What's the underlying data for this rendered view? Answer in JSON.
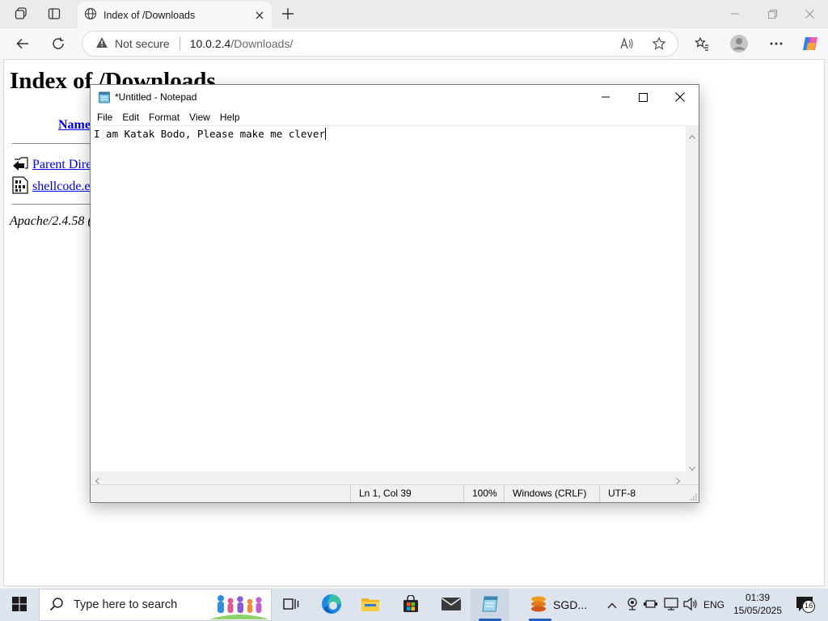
{
  "browser": {
    "tab_title": "Index of /Downloads",
    "security_label": "Not secure",
    "url_host": "10.0.2.4",
    "url_path": "/Downloads/"
  },
  "page": {
    "heading": "Index of /Downloads",
    "column_name": "Name",
    "rows": [
      {
        "label": "Parent Dire",
        "icon": "back-folder-icon"
      },
      {
        "label": "shellcode.e",
        "icon": "binary-file-icon"
      }
    ],
    "server_signature": "Apache/2.4.58 ("
  },
  "notepad": {
    "title": "*Untitled - Notepad",
    "menu": [
      "File",
      "Edit",
      "Format",
      "View",
      "Help"
    ],
    "content": "I am Katak Bodo, Please make me clever",
    "status": {
      "position": "Ln 1, Col 39",
      "zoom": "100%",
      "line_ending": "Windows (CRLF)",
      "encoding": "UTF-8"
    }
  },
  "taskbar": {
    "search_placeholder": "Type here to search",
    "pinned": [
      "task-view-icon",
      "edge-icon",
      "file-explorer-icon",
      "store-icon",
      "mail-icon",
      "notepad-icon"
    ],
    "running_app_label": "SGD...",
    "language": "ENG",
    "time": "01:39",
    "date": "15/05/2025",
    "notification_count": "16"
  },
  "colors": {
    "link": "#0000ee",
    "taskbar": "#dde4ee",
    "accent": "#1f5fbf"
  }
}
